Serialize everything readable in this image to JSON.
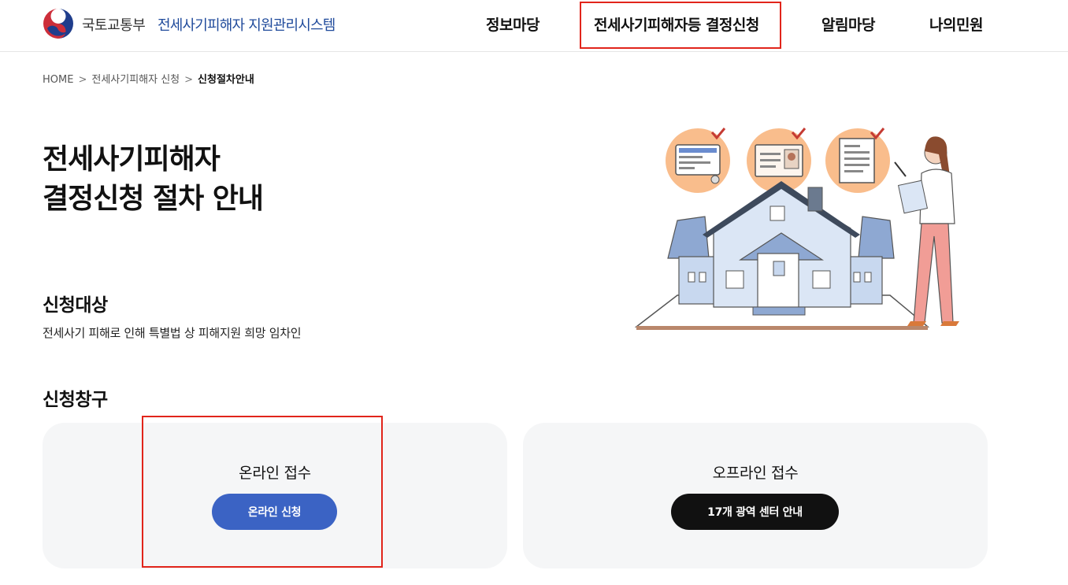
{
  "header": {
    "ministry": "국토교통부",
    "system_name": "전세사기피해자 지원관리시스템",
    "nav": [
      {
        "label": "정보마당"
      },
      {
        "label": "전세사기피해자등 결정신청"
      },
      {
        "label": "알림마당"
      },
      {
        "label": "나의민원"
      }
    ]
  },
  "breadcrumb": {
    "home": "HOME",
    "level1": "전세사기피해자 신청",
    "current": "신청절차안내",
    "separator": ">"
  },
  "page": {
    "title_line1": "전세사기피해자",
    "title_line2": "결정신청 절차 안내"
  },
  "target": {
    "heading": "신청대상",
    "description": "전세사기 피해로 인해 특별법 상 피해지원 희망 임차인"
  },
  "channel": {
    "heading": "신청창구",
    "online": {
      "title": "온라인 접수",
      "button": "온라인 신청"
    },
    "offline": {
      "title": "오프라인 접수",
      "button": "17개 광역 센터 안내"
    }
  },
  "colors": {
    "brand_blue": "#1f4a9b",
    "online_button": "#3b63c4",
    "offline_button": "#111111",
    "card_bg": "#f5f6f7",
    "highlight_red": "#e1251b"
  },
  "icons": [
    "government-taegeuk-logo",
    "house-illustration",
    "checklist-icons",
    "woman-with-clipboard"
  ]
}
